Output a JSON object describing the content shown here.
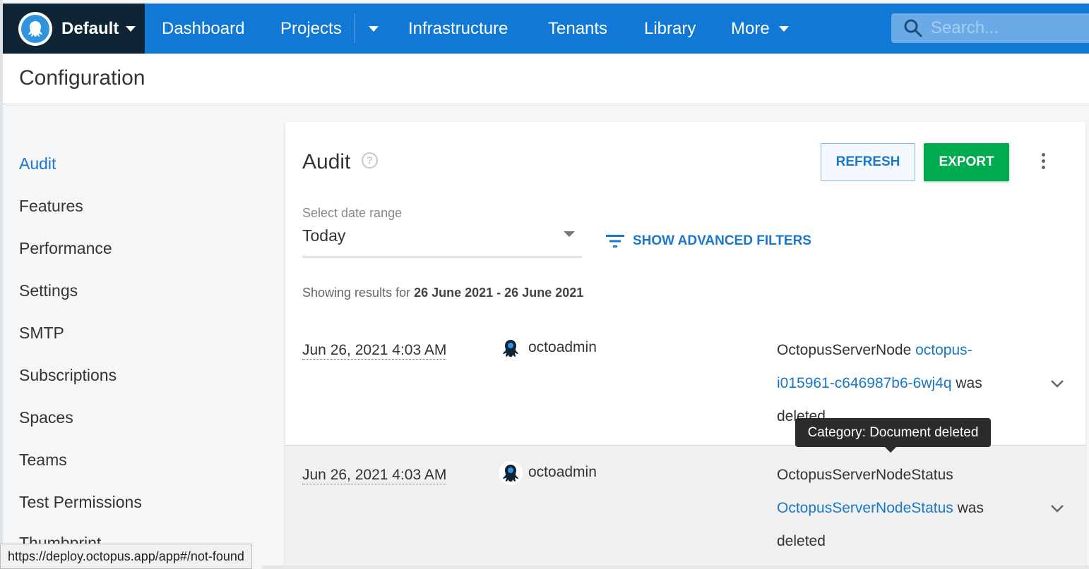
{
  "topnav": {
    "space_name": "Default",
    "items": {
      "dashboard": "Dashboard",
      "projects": "Projects",
      "infrastructure": "Infrastructure",
      "tenants": "Tenants",
      "library": "Library",
      "more": "More"
    },
    "search_placeholder": "Search...",
    "colors": {
      "bar": "#1278d6",
      "space_switcher": "#0f2535"
    }
  },
  "header": {
    "title": "Configuration"
  },
  "sidebar": {
    "items": [
      {
        "label": "Audit",
        "active": true
      },
      {
        "label": "Features"
      },
      {
        "label": "Performance"
      },
      {
        "label": "Settings"
      },
      {
        "label": "SMTP"
      },
      {
        "label": "Subscriptions"
      },
      {
        "label": "Spaces"
      },
      {
        "label": "Teams"
      },
      {
        "label": "Test Permissions"
      },
      {
        "label": "Thumbprint"
      }
    ]
  },
  "audit": {
    "title": "Audit",
    "refresh_label": "REFRESH",
    "export_label": "EXPORT",
    "date_range_label": "Select date range",
    "date_range_value": "Today",
    "advanced_filters_label": "SHOW ADVANCED FILTERS",
    "showing_prefix": "Showing results for",
    "showing_range": "26 June 2021 - 26 June 2021",
    "entries": [
      {
        "date": "Jun 26, 2021 4:03 AM",
        "user": "octoadmin",
        "msg_prefix": "OctopusServerNode",
        "msg_link": "octopus-i015961-c646987b6-6wj4q",
        "msg_suffix": "was deleted"
      },
      {
        "date": "Jun 26, 2021 4:03 AM",
        "user": "octoadmin",
        "msg_prefix": "OctopusServerNodeStatus",
        "msg_link": "OctopusServerNodeStatus",
        "msg_suffix": "was deleted"
      }
    ],
    "tooltip": "Category: Document deleted"
  },
  "status_bar": {
    "url": "https://deploy.octopus.app/app#/not-found"
  }
}
